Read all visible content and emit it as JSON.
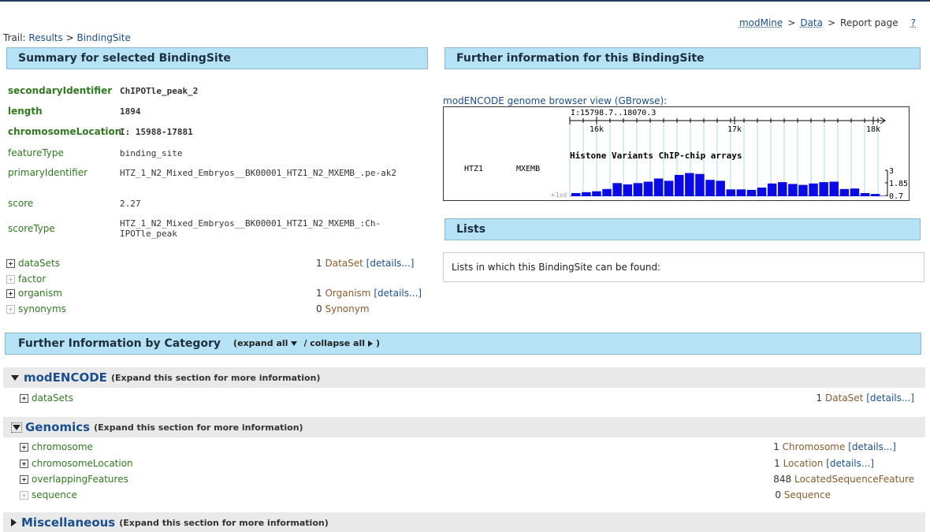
{
  "topnav": {
    "home": "modMine",
    "sep1": ">",
    "data": "Data",
    "sep2": ">",
    "current": "Report page",
    "help": "?"
  },
  "trail": {
    "label": "Trail:",
    "results": "Results",
    "sep": ">",
    "current": "BindingSite"
  },
  "summary_bar": "Summary for selected BindingSite",
  "further_bar": "Further information for this BindingSite",
  "summary": [
    {
      "key": "secondaryIdentifier",
      "value": "ChIPOTle_peak_2"
    },
    {
      "key": "length",
      "value": "1894"
    },
    {
      "key": "chromosomeLocation",
      "value": "I: 15988-17881"
    },
    {
      "key": "featureType",
      "value": "binding_site"
    },
    {
      "key": "primaryIdentifier",
      "value": "HTZ_1_N2_Mixed_Embryos__BK00001_HTZ1_N2_MXEMB_.pe-ak2"
    },
    {
      "key": "score",
      "value": "2.27"
    },
    {
      "key": "scoreType",
      "value": "HTZ_1_N2_Mixed_Embryos__BK00001_HTZ1_N2_MXEMB_:Ch-IPOTle_peak"
    }
  ],
  "collections": [
    {
      "name": "dataSets",
      "count": "1",
      "type": "DataSet",
      "details": "[details...]"
    },
    {
      "name": "factor",
      "count": "",
      "type": "",
      "details": ""
    },
    {
      "name": "organism",
      "count": "1",
      "type": "Organism",
      "details": "[details...]"
    },
    {
      "name": "synonyms",
      "count": "0",
      "type": "Synonym",
      "details": ""
    }
  ],
  "gbrowse": {
    "label": "modENCODE genome browser view (GBrowse):",
    "range": "I:15798.7..18070.3",
    "ticks": [
      "16k",
      "17k",
      "18k"
    ],
    "track_title": "Histone Variants ChIP-chip arrays",
    "track_left1": "HTZ1",
    "track_left2": "MXEMB",
    "scale_max": "3",
    "scale_mid": "1.85",
    "scale_min": "0.7",
    "sd_label": "+1sd",
    "bar_values": [
      0.35,
      0.45,
      0.55,
      0.8,
      1.45,
      1.3,
      1.45,
      1.6,
      1.95,
      1.7,
      2.35,
      2.55,
      2.45,
      1.8,
      1.7,
      0.75,
      0.75,
      0.7,
      0.95,
      1.4,
      1.55,
      1.35,
      1.25,
      1.4,
      1.55,
      1.6,
      0.8,
      0.85,
      0.35,
      0.25
    ]
  },
  "lists_bar": "Lists",
  "lists_text": "Lists in which this BindingSite can be found:",
  "category_bar": {
    "title": "Further Information by Category",
    "expand": "(expand all",
    "collapse": "/ collapse all",
    "close": ")"
  },
  "categories": [
    {
      "title": "modENCODE",
      "hint": "(Expand this section for more information)",
      "rows": [
        {
          "name": "dataSets",
          "count": "1",
          "type": "DataSet",
          "details": "[details...]"
        }
      ]
    },
    {
      "title": "Genomics",
      "hint": "(Expand this section for more information)",
      "rows": [
        {
          "name": "chromosome",
          "count": "1",
          "type": "Chromosome",
          "details": "[details...]"
        },
        {
          "name": "chromosomeLocation",
          "count": "1",
          "type": "Location",
          "details": "[details...]"
        },
        {
          "name": "overlappingFeatures",
          "count": "848",
          "type": "LocatedSequenceFeature",
          "details": ""
        },
        {
          "name": "sequence",
          "count": "0",
          "type": "Sequence",
          "details": ""
        }
      ]
    },
    {
      "title": "Miscellaneous",
      "hint": "(Expand this section for more information)",
      "rows": []
    }
  ]
}
